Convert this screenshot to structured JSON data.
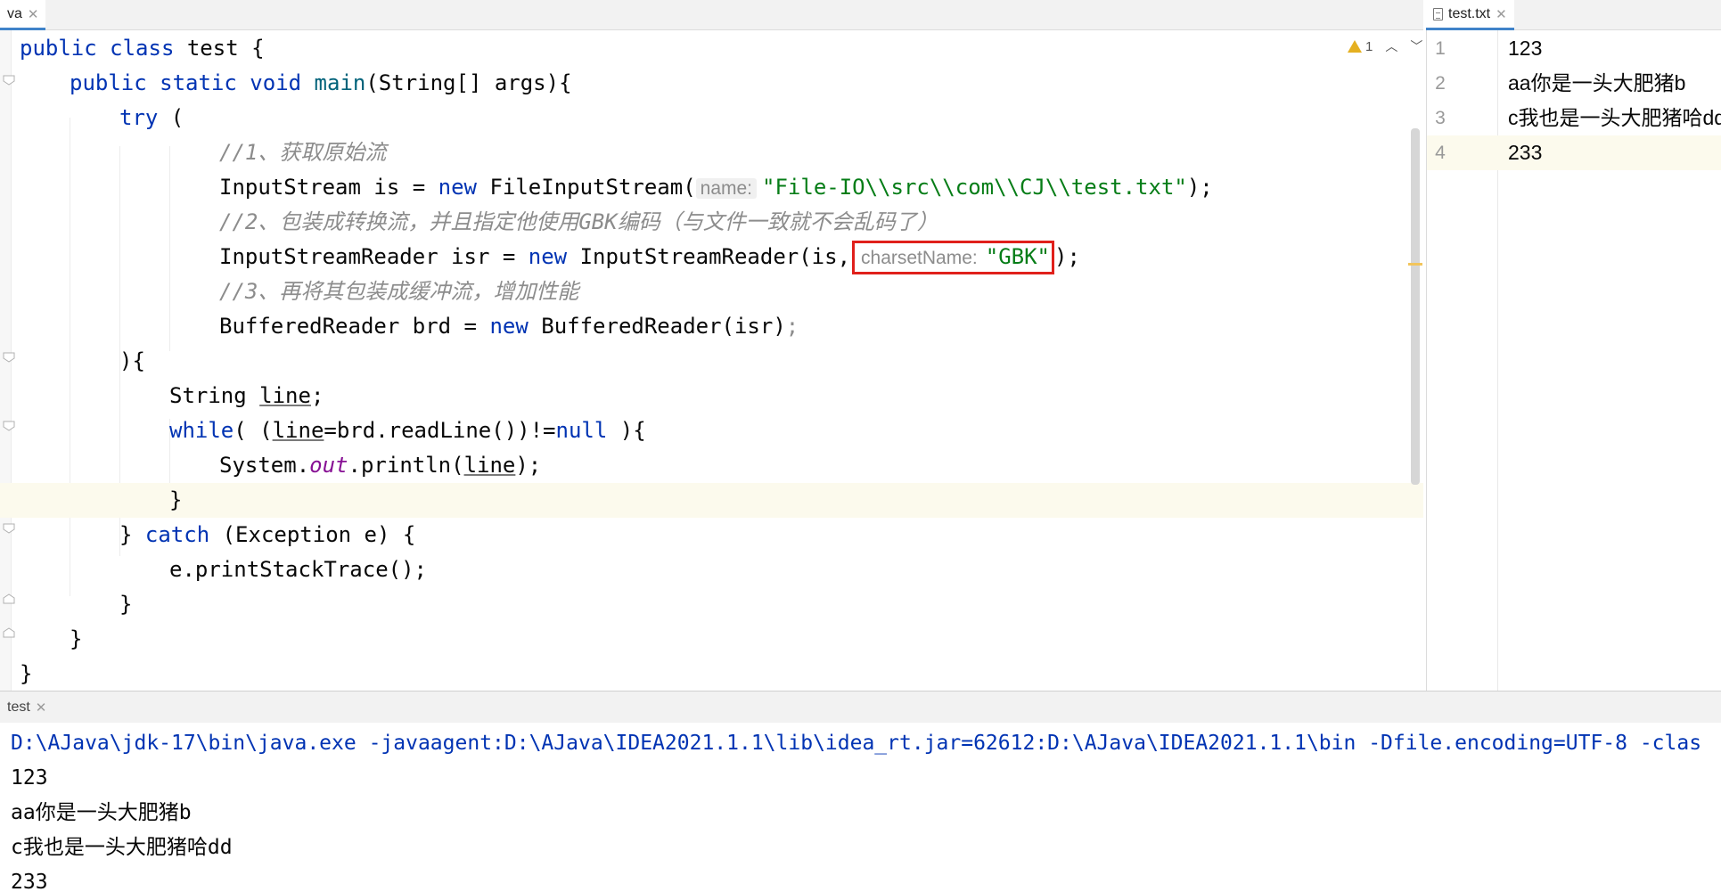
{
  "left_tab": {
    "label": "va"
  },
  "right_tab": {
    "label": "test.txt"
  },
  "editor": {
    "warning_count": "1",
    "lines": {
      "l1": {
        "a": "public class",
        "b": " test {"
      },
      "l2": {
        "a": "public static void",
        "b": "main",
        "c": "(String[] args){"
      },
      "l3": {
        "a": "try",
        "b": " ("
      },
      "l4": {
        "a": "//1、获取原始流"
      },
      "l5": {
        "a": "InputStream is = ",
        "b": "new",
        "c": " FileInputStream(",
        "hint": "name:",
        "d": "\"File-IO\\\\src\\\\com\\\\CJ\\\\test.txt\"",
        "e": ");"
      },
      "l6": {
        "a": "//2、包装成转换流，并且指定他使用GBK编码（与文件一致就不会乱码了）"
      },
      "l7": {
        "a": "InputStreamReader isr = ",
        "b": "new",
        "c": " InputStreamReader(is,",
        "hint": "charsetName:",
        "d": "\"GBK\"",
        "e": ");"
      },
      "l8": {
        "a": "//3、再将其包装成缓冲流，增加性能"
      },
      "l9": {
        "a": "BufferedReader brd = ",
        "b": "new",
        "c": " BufferedReader(isr)",
        "d": ";"
      },
      "l10": {
        "a": "){"
      },
      "l11": {
        "a": "String ",
        "b": "line",
        "c": ";"
      },
      "l12": {
        "a": "while",
        "b": "( (",
        "c": "line",
        "d": "=brd.readLine())!=",
        "e": "null",
        "f": " ){"
      },
      "l13": {
        "a": "System.",
        "b": "out",
        "c": ".println(",
        "d": "line",
        "e": ");"
      },
      "l14": {
        "a": "}"
      },
      "l15": {
        "a": "} ",
        "b": "catch",
        "c": " (Exception e) {"
      },
      "l16": {
        "a": "e.printStackTrace();"
      },
      "l17": {
        "a": "}"
      },
      "l18": {
        "a": "}"
      },
      "l19": {
        "a": "}"
      }
    }
  },
  "txt_file": {
    "lines": [
      {
        "num": "1",
        "text": "123"
      },
      {
        "num": "2",
        "text": "aa你是一头大肥猪b"
      },
      {
        "num": "3",
        "text": "c我也是一头大肥猪哈dd"
      },
      {
        "num": "4",
        "text": "233"
      }
    ]
  },
  "run": {
    "tab_label": "test",
    "command": "D:\\AJava\\jdk-17\\bin\\java.exe -javaagent:D:\\AJava\\IDEA2021.1.1\\lib\\idea_rt.jar=62612:D:\\AJava\\IDEA2021.1.1\\bin -Dfile.encoding=UTF-8 -clas",
    "output": [
      "123",
      "aa你是一头大肥猪b",
      "c我也是一头大肥猪哈dd",
      "233"
    ]
  },
  "colors": {
    "keyword": "#0033b3",
    "string": "#067d17",
    "comment": "#8c8c8c",
    "method": "#00627a",
    "static_field": "#871094",
    "highlight_box": "#e0201b",
    "current_line": "#fcfaed"
  }
}
